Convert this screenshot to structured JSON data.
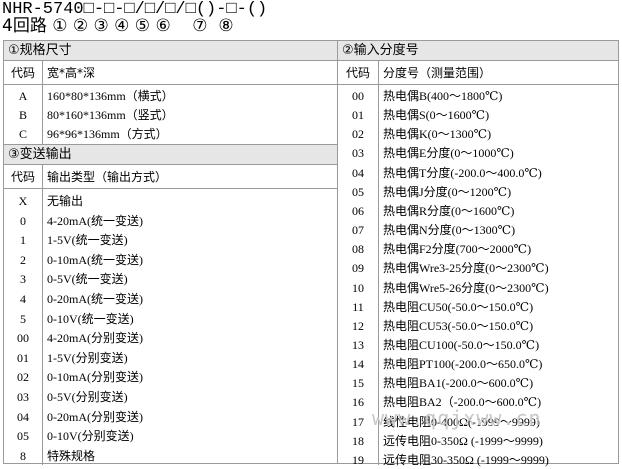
{
  "header": {
    "model": "NHR-5740□-□-□/□/□/□()-□-()",
    "numbering": "4回路 ① ② ③ ④ ⑤ ⑥    ⑦  ⑧"
  },
  "section1": {
    "title": "①规格尺寸",
    "col_code": "代码",
    "col_desc": "宽*高*深",
    "rows": [
      {
        "code": "A",
        "desc": "160*80*136mm（横式）"
      },
      {
        "code": "B",
        "desc": "80*160*136mm（竖式）"
      },
      {
        "code": "C",
        "desc": "96*96*136mm（方式）"
      }
    ]
  },
  "section3": {
    "title": "③变送输出",
    "col_code": "代码",
    "col_desc": "输出类型（输出方式）",
    "rows": [
      {
        "code": "X",
        "desc": "无输出"
      },
      {
        "code": "0",
        "desc": "4-20mA(统一变送)"
      },
      {
        "code": "1",
        "desc": "1-5V(统一变送)"
      },
      {
        "code": "2",
        "desc": "0-10mA(统一变送)"
      },
      {
        "code": "3",
        "desc": "0-5V(统一变送)"
      },
      {
        "code": "4",
        "desc": "0-20mA(统一变送)"
      },
      {
        "code": "5",
        "desc": "0-10V(统一变送)"
      },
      {
        "code": "00",
        "desc": "4-20mA(分别变送)"
      },
      {
        "code": "01",
        "desc": "1-5V(分别变送)"
      },
      {
        "code": "02",
        "desc": "0-10mA(分别变送)"
      },
      {
        "code": "03",
        "desc": "0-5V(分别变送)"
      },
      {
        "code": "04",
        "desc": "0-20mA(分别变送)"
      },
      {
        "code": "05",
        "desc": "0-10V(分别变送)"
      },
      {
        "code": "8",
        "desc": "特殊规格"
      }
    ]
  },
  "section2": {
    "title": "②输入分度号",
    "col_code": "代码",
    "col_desc": "分度号（测量范围）",
    "rows": [
      {
        "code": "00",
        "desc": "热电偶B(400～1800℃)"
      },
      {
        "code": "01",
        "desc": "热电偶S(0～1600℃)"
      },
      {
        "code": "02",
        "desc": "热电偶K(0～1300℃)"
      },
      {
        "code": "03",
        "desc": "热电偶E分度(0～1000℃)"
      },
      {
        "code": "04",
        "desc": "热电偶T分度(-200.0～400.0℃)"
      },
      {
        "code": "05",
        "desc": "热电偶J分度(0～1200℃)"
      },
      {
        "code": "06",
        "desc": "热电偶R分度(0～1600℃)"
      },
      {
        "code": "07",
        "desc": "热电偶N分度(0～1300℃)"
      },
      {
        "code": "08",
        "desc": "热电偶F2分度(700～2000℃)"
      },
      {
        "code": "09",
        "desc": "热电偶Wre3-25分度(0～2300℃)"
      },
      {
        "code": "10",
        "desc": "热电偶Wre5-26分度(0～2300℃)"
      },
      {
        "code": "11",
        "desc": "热电阻CU50(-50.0～150.0℃)"
      },
      {
        "code": "12",
        "desc": "热电阻CU53(-50.0～150.0℃)"
      },
      {
        "code": "13",
        "desc": "热电阻CU100(-50.0～150.0℃)"
      },
      {
        "code": "14",
        "desc": "热电阻PT100(-200.0～650.0℃)"
      },
      {
        "code": "15",
        "desc": "热电阻BA1(-200.0～600.0℃)"
      },
      {
        "code": "16",
        "desc": "热电阻BA2（-200.0～600.0℃)"
      },
      {
        "code": "17",
        "desc": "线性电阻0-400Ω(-1999～9999)"
      },
      {
        "code": "18",
        "desc": "远传电阻0-350Ω (-1999～9999)"
      },
      {
        "code": "19",
        "desc": "远传电阻30-350Ω (-1999～9999)"
      }
    ]
  },
  "watermark": "www.qqjxww.cn"
}
